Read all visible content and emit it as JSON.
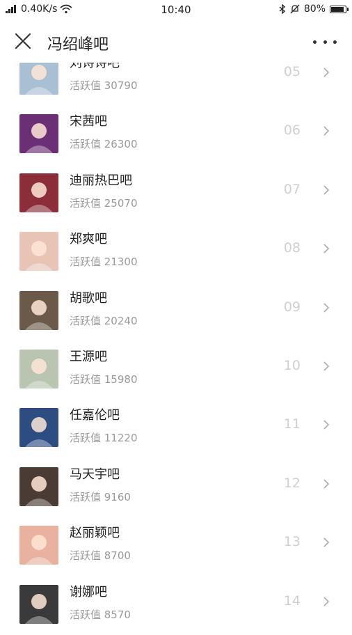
{
  "status_bar": {
    "network_speed": "0.40K/s",
    "time": "10:40",
    "battery": "80%"
  },
  "header": {
    "title": "冯绍峰吧"
  },
  "items": [
    {
      "name": "刘诗诗吧",
      "activity": "活跃值 30790",
      "rank": "05",
      "avatar_color": "#a9bfd3"
    },
    {
      "name": "宋茜吧",
      "activity": "活跃值 26300",
      "rank": "06",
      "avatar_color": "#6a2f74"
    },
    {
      "name": "迪丽热巴吧",
      "activity": "活跃值 25070",
      "rank": "07",
      "avatar_color": "#8b2e3a"
    },
    {
      "name": "郑爽吧",
      "activity": "活跃值 21300",
      "rank": "08",
      "avatar_color": "#e7c4b6"
    },
    {
      "name": "胡歌吧",
      "activity": "活跃值 20240",
      "rank": "09",
      "avatar_color": "#6b5a4a"
    },
    {
      "name": "王源吧",
      "activity": "活跃值 15980",
      "rank": "10",
      "avatar_color": "#b9c4b1"
    },
    {
      "name": "任嘉伦吧",
      "activity": "活跃值 11220",
      "rank": "11",
      "avatar_color": "#2d4d82"
    },
    {
      "name": "马天宇吧",
      "activity": "活跃值 9160",
      "rank": "12",
      "avatar_color": "#4a3b34"
    },
    {
      "name": "赵丽颖吧",
      "activity": "活跃值 8700",
      "rank": "13",
      "avatar_color": "#e9b1a0"
    },
    {
      "name": "谢娜吧",
      "activity": "活跃值 8570",
      "rank": "14",
      "avatar_color": "#3a3a3a"
    }
  ]
}
